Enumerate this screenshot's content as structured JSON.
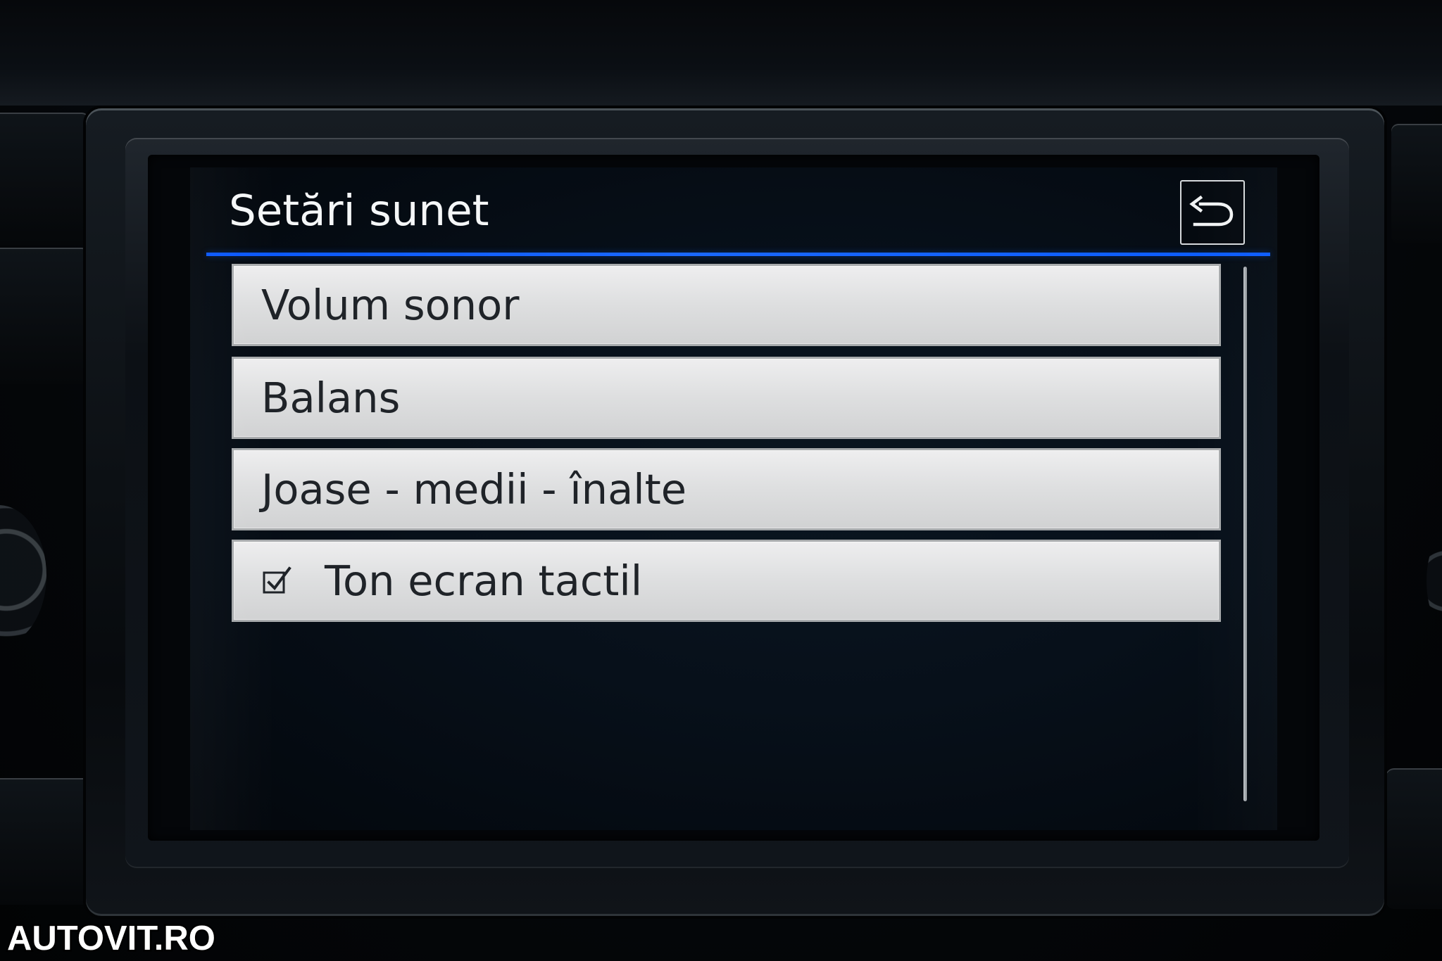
{
  "screen": {
    "title": "Setări sunet",
    "back_icon": "back-arrow-icon"
  },
  "menu": {
    "items": [
      {
        "label": "Volum sonor"
      },
      {
        "label": "Balans"
      },
      {
        "label": "Joase - medii - înalte"
      },
      {
        "label": "Ton ecran tactil",
        "checked": true,
        "checkbox_icon": "checkmark-icon"
      }
    ]
  },
  "watermark": {
    "text": "AUTOVIT.RO"
  },
  "colors": {
    "screen_background": "#07101a",
    "accent_rule": "#1a68ff",
    "menu_item_background": "#dedfe0",
    "menu_item_text": "#1f2328"
  }
}
